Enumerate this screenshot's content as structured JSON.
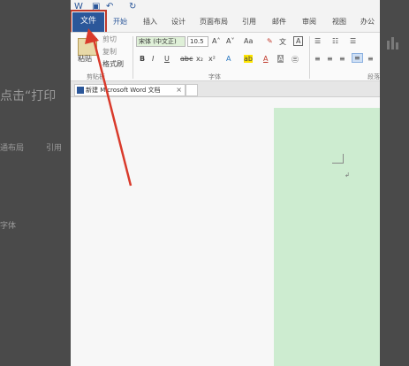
{
  "background": {
    "left_texts": [
      "点击“打印",
      "通布局",
      "引用",
      "字体"
    ],
    "right_marks": 3
  },
  "quick_access": {
    "save_icon": "save-icon",
    "undo_icon": "undo-icon",
    "redo_icon": "redo-icon"
  },
  "tabs": {
    "file": "文件",
    "items": [
      "开始",
      "插入",
      "设计",
      "页面布局",
      "引用",
      "邮件",
      "审阅",
      "视图",
      "办公"
    ]
  },
  "ribbon": {
    "paste": "粘贴",
    "cut": "剪切",
    "copy": "复制",
    "format_painter": "格式刷",
    "clipboard": "剪贴板",
    "font_name": "宋体 (中文正)",
    "font_size": "10.5",
    "font_group": "字体",
    "paragraph_group": "段落",
    "bold": "B",
    "italic": "I",
    "underline": "U",
    "strike": "abc",
    "sub": "x₂",
    "sup": "x²",
    "grow": "A˄",
    "shrink": "A˅",
    "aa": "Aa"
  },
  "doc": {
    "tab_title": "新建 Microsoft Word 文档",
    "close": "×",
    "paragraph_mark": "↲"
  },
  "colors": {
    "accent": "#2b579a",
    "arrow": "#d93a2b",
    "page_green": "#cdecd0"
  }
}
